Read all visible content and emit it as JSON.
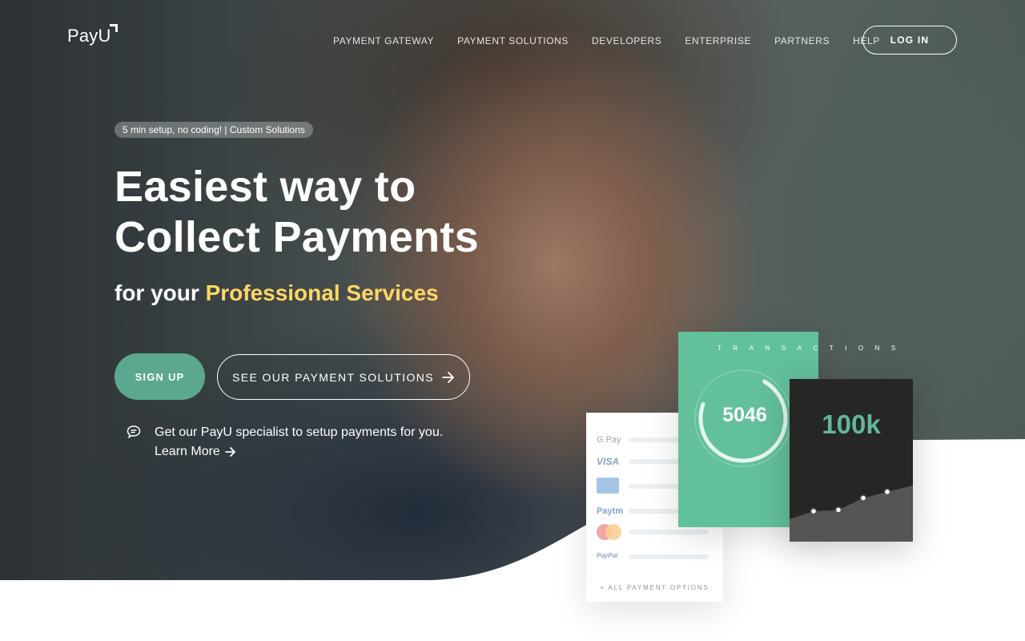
{
  "brand": {
    "logo_text": "PayU",
    "accent_color": "#5ba88f",
    "highlight_color": "#ffd766"
  },
  "nav": {
    "items": [
      "PAYMENT GATEWAY",
      "PAYMENT SOLUTIONS",
      "DEVELOPERS",
      "ENTERPRISE",
      "PARTNERS",
      "HELP"
    ],
    "login_label": "LOG IN"
  },
  "hero": {
    "pill": "5 min setup, no coding! | Custom Solutions",
    "title_line1": "Easiest way to",
    "title_line2": "Collect Payments",
    "subtitle_prefix": "for your",
    "subtitle_accent": "Professional Services",
    "signup_label": "SIGN UP",
    "solutions_label": "SEE OUR PAYMENT SOLUTIONS",
    "specialist_text": "Get our PayU specialist to setup payments for you.",
    "learn_more": "Learn More"
  },
  "payment_card": {
    "logos": [
      "G Pay",
      "VISA",
      "AMEX",
      "Paytm",
      "Mastercard",
      "PayPal"
    ],
    "footer": "+ ALL PAYMENT OPTIONS"
  },
  "transactions_card": {
    "label": "TRANSACTIONS",
    "value": "5046",
    "ring_fraction": 0.72
  },
  "volume_card": {
    "value": "100k",
    "trend_points": [
      0.18,
      0.21,
      0.48,
      0.62
    ]
  }
}
